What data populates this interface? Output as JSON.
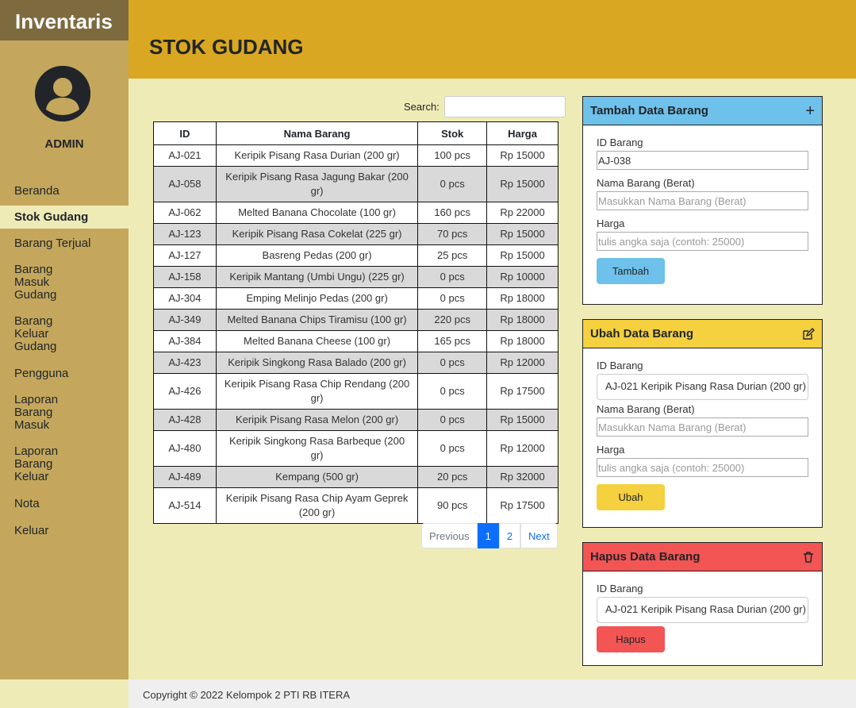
{
  "sidebar": {
    "brand": "Inventaris",
    "user": "ADMIN",
    "items": [
      {
        "label": "Beranda"
      },
      {
        "label": "Stok Gudang"
      },
      {
        "label": "Barang Terjual"
      },
      {
        "label": "Barang Masuk Gudang"
      },
      {
        "label": "Barang Keluar Gudang"
      },
      {
        "label": "Pengguna"
      },
      {
        "label": "Laporan Barang Masuk"
      },
      {
        "label": "Laporan Barang Keluar"
      },
      {
        "label": "Nota"
      },
      {
        "label": "Keluar"
      }
    ]
  },
  "header": {
    "title": "STOK GUDANG"
  },
  "search": {
    "label": "Search:",
    "value": ""
  },
  "table": {
    "headers": [
      "ID",
      "Nama Barang",
      "Stok",
      "Harga"
    ],
    "rows": [
      [
        "AJ-021",
        "Keripik Pisang Rasa Durian (200 gr)",
        "100 pcs",
        "Rp 15000"
      ],
      [
        "AJ-058",
        "Keripik Pisang Rasa Jagung Bakar (200 gr)",
        "0 pcs",
        "Rp 15000"
      ],
      [
        "AJ-062",
        "Melted Banana Chocolate (100 gr)",
        "160 pcs",
        "Rp 22000"
      ],
      [
        "AJ-123",
        "Keripik Pisang Rasa Cokelat (225 gr)",
        "70 pcs",
        "Rp 15000"
      ],
      [
        "AJ-127",
        "Basreng Pedas (200 gr)",
        "25 pcs",
        "Rp 15000"
      ],
      [
        "AJ-158",
        "Keripik Mantang (Umbi Ungu) (225 gr)",
        "0 pcs",
        "Rp 10000"
      ],
      [
        "AJ-304",
        "Emping Melinjo Pedas (200 gr)",
        "0 pcs",
        "Rp 18000"
      ],
      [
        "AJ-349",
        "Melted Banana Chips Tiramisu (100 gr)",
        "220 pcs",
        "Rp 18000"
      ],
      [
        "AJ-384",
        "Melted Banana Cheese (100 gr)",
        "165 pcs",
        "Rp 18000"
      ],
      [
        "AJ-423",
        "Keripik Singkong Rasa Balado (200 gr)",
        "0 pcs",
        "Rp 12000"
      ],
      [
        "AJ-426",
        "Keripik Pisang Rasa Chip Rendang (200 gr)",
        "0 pcs",
        "Rp 17500"
      ],
      [
        "AJ-428",
        "Keripik Pisang Rasa Melon (200 gr)",
        "0 pcs",
        "Rp 15000"
      ],
      [
        "AJ-480",
        "Keripik Singkong Rasa Barbeque (200 gr)",
        "0 pcs",
        "Rp 12000"
      ],
      [
        "AJ-489",
        "Kempang (500 gr)",
        "20 pcs",
        "Rp 32000"
      ],
      [
        "AJ-514",
        "Keripik Pisang Rasa Chip Ayam Geprek (200 gr)",
        "90 pcs",
        "Rp 17500"
      ]
    ]
  },
  "pagination": {
    "previous": "Previous",
    "pages": [
      "1",
      "2"
    ],
    "current": "1",
    "next": "Next"
  },
  "add_card": {
    "title": "Tambah Data Barang",
    "id_label": "ID Barang",
    "id_value": "AJ-038",
    "name_label": "Nama Barang (Berat)",
    "name_placeholder": "Masukkan Nama Barang (Berat)",
    "price_label": "Harga",
    "price_placeholder": "tulis angka saja (contoh: 25000)",
    "button": "Tambah",
    "header_color": "#6ec1ea",
    "button_color": "#6ec1ea"
  },
  "edit_card": {
    "title": "Ubah Data Barang",
    "id_label": "ID Barang",
    "id_value": "AJ-021 Keripik Pisang Rasa Durian (200 gr)",
    "name_label": "Nama Barang (Berat)",
    "name_placeholder": "Masukkan Nama Barang (Berat)",
    "price_label": "Harga",
    "price_placeholder": "tulis angka saja (contoh: 25000)",
    "button": "Ubah",
    "header_color": "#f5d03f",
    "button_color": "#f5d03f"
  },
  "delete_card": {
    "title": "Hapus Data Barang",
    "id_label": "ID Barang",
    "id_value": "AJ-021 Keripik Pisang Rasa Durian (200 gr)",
    "button": "Hapus",
    "header_color": "#f35454",
    "button_color": "#f35454"
  },
  "footer": {
    "text": "Copyright © 2022 Kelompok 2 PTI RB ITERA"
  }
}
